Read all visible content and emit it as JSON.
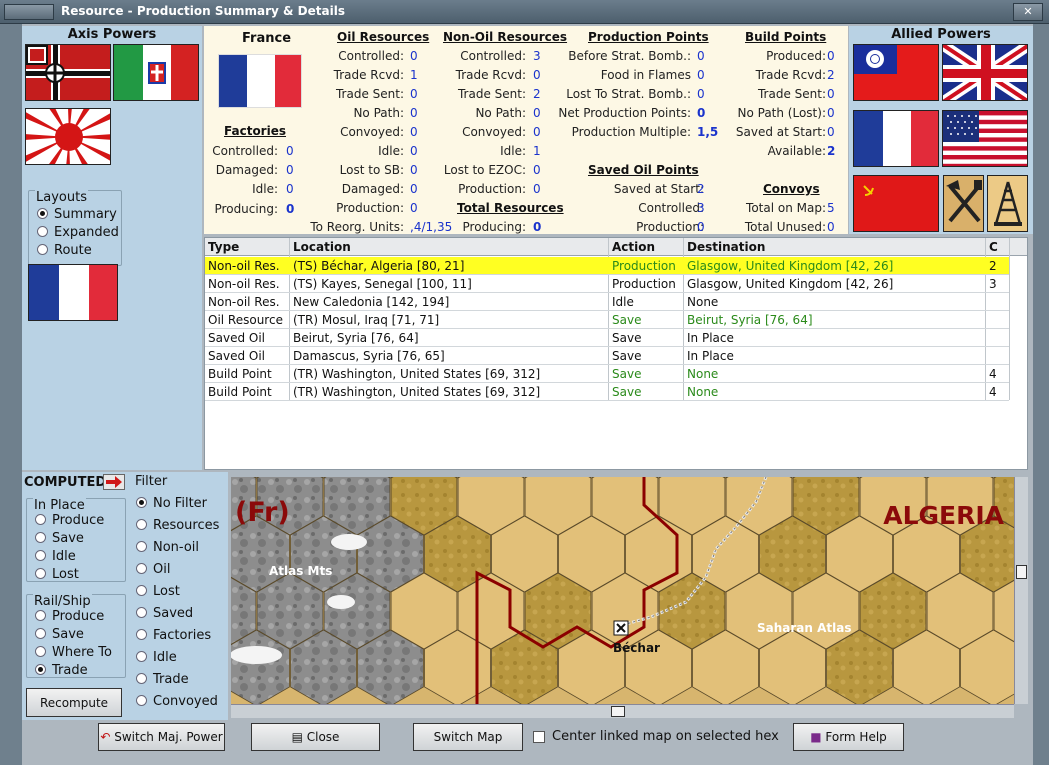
{
  "window": {
    "title": "Resource - Production Summary & Details",
    "close_glyph": "✕"
  },
  "axis": {
    "title": "Axis Powers"
  },
  "allied": {
    "title": "Allied Powers"
  },
  "layouts": {
    "title": "Layouts",
    "options": [
      "Summary",
      "Expanded",
      "Route"
    ],
    "selected": "Summary"
  },
  "summary": {
    "country": "France",
    "factories": {
      "title": "Factories",
      "rows": [
        {
          "label": "Controlled:",
          "value": "0"
        },
        {
          "label": "Damaged:",
          "value": "0"
        },
        {
          "label": "Idle:",
          "value": "0"
        },
        {
          "label": "Producing:",
          "value": "0"
        }
      ]
    },
    "oil": {
      "title": "Oil Resources",
      "rows": [
        {
          "label": "Controlled:",
          "value": "0"
        },
        {
          "label": "Trade Rcvd:",
          "value": "1"
        },
        {
          "label": "Trade Sent:",
          "value": "0"
        },
        {
          "label": "No Path:",
          "value": "0"
        },
        {
          "label": "Convoyed:",
          "value": "0"
        },
        {
          "label": "Idle:",
          "value": "0"
        },
        {
          "label": "Lost to SB:",
          "value": "0"
        },
        {
          "label": "Damaged:",
          "value": "0"
        },
        {
          "label": "Production:",
          "value": "0"
        },
        {
          "label": "To Reorg. Units:",
          "value": ",4/1,35"
        }
      ]
    },
    "nonoil": {
      "title": "Non-Oil Resources",
      "rows": [
        {
          "label": "Controlled:",
          "value": "3"
        },
        {
          "label": "Trade Rcvd:",
          "value": "0"
        },
        {
          "label": "Trade Sent:",
          "value": "2"
        },
        {
          "label": "No Path:",
          "value": "0"
        },
        {
          "label": "Convoyed:",
          "value": "0"
        },
        {
          "label": "Idle:",
          "value": "1"
        },
        {
          "label": "Lost to EZOC:",
          "value": "0"
        },
        {
          "label": "Production:",
          "value": "0"
        }
      ]
    },
    "total": {
      "title": "Total Resources",
      "label": "Producing:",
      "value": "0"
    },
    "pp": {
      "title": "Production Points",
      "rows": [
        {
          "label": "Before Strat. Bomb.:",
          "value": "0"
        },
        {
          "label": "Food in Flames",
          "value": "0"
        },
        {
          "label": "Lost To Strat. Bomb.:",
          "value": "0"
        },
        {
          "label": "Net Production Points:",
          "value": "0"
        },
        {
          "label": "Production Multiple:",
          "value": "1,5"
        }
      ]
    },
    "saved_oil": {
      "title": "Saved Oil Points",
      "rows": [
        {
          "label": "Saved at Start:",
          "value": "2"
        },
        {
          "label": "Controlled:",
          "value": "3"
        },
        {
          "label": "Production:",
          "value": "0"
        }
      ]
    },
    "bp": {
      "title": "Build Points",
      "rows": [
        {
          "label": "Produced:",
          "value": "0"
        },
        {
          "label": "Trade Rcvd:",
          "value": "2"
        },
        {
          "label": "Trade Sent:",
          "value": "0"
        },
        {
          "label": "No Path (Lost):",
          "value": "0"
        },
        {
          "label": "Saved at Start:",
          "value": "0"
        },
        {
          "label": "Available:",
          "value": "2"
        }
      ]
    },
    "convoys": {
      "title": "Convoys",
      "rows": [
        {
          "label": "Total on Map:",
          "value": "5"
        },
        {
          "label": "Total Unused:",
          "value": "0"
        }
      ]
    }
  },
  "table": {
    "headers": [
      "Type",
      "Location",
      "Action",
      "Destination",
      "C"
    ],
    "rows": [
      {
        "type": "Non-oil Res.",
        "location": "(TS) Béchar, Algeria [80, 21]",
        "action": "Production",
        "destination": "Glasgow, United Kingdom [42, 26]",
        "c": "2",
        "selected": true,
        "green": true
      },
      {
        "type": "Non-oil Res.",
        "location": "(TS) Kayes, Senegal [100, 11]",
        "action": "Production",
        "destination": "Glasgow, United Kingdom [42, 26]",
        "c": "3",
        "selected": false,
        "green": false
      },
      {
        "type": "Non-oil Res.",
        "location": "New Caledonia [142, 194]",
        "action": "Idle",
        "destination": "None",
        "c": "",
        "selected": false,
        "green": false
      },
      {
        "type": "Oil Resource",
        "location": "(TR) Mosul, Iraq [71, 71]",
        "action": "Save",
        "destination": "Beirut, Syria [76, 64]",
        "c": "",
        "selected": false,
        "green": true
      },
      {
        "type": "Saved Oil",
        "location": "Beirut, Syria [76, 64]",
        "action": "Save",
        "destination": "In Place",
        "c": "",
        "selected": false,
        "green": false
      },
      {
        "type": "Saved Oil",
        "location": "Damascus, Syria [76, 65]",
        "action": "Save",
        "destination": "In Place",
        "c": "",
        "selected": false,
        "green": false
      },
      {
        "type": "Build Point",
        "location": "(TR) Washington, United States [69, 312]",
        "action": "Save",
        "destination": "None",
        "c": "4",
        "selected": false,
        "green": true
      },
      {
        "type": "Build Point",
        "location": "(TR) Washington, United States [69, 312]",
        "action": "Save",
        "destination": "None",
        "c": "4",
        "selected": false,
        "green": true
      }
    ]
  },
  "computed": {
    "title": "COMPUTED",
    "in_place": {
      "title": "In Place",
      "options": [
        "Produce",
        "Save",
        "Idle",
        "Lost"
      ]
    },
    "rail_ship": {
      "title": "Rail/Ship",
      "options": [
        "Produce",
        "Save",
        "Where To",
        "Trade"
      ],
      "selected": "Trade"
    },
    "recompute_label": "Recompute"
  },
  "filter": {
    "title": "Filter",
    "options": [
      "No Filter",
      "Resources",
      "Non-oil",
      "Oil",
      "Lost",
      "Saved",
      "Factories",
      "Idle",
      "Trade",
      "Convoyed"
    ],
    "selected": "No Filter"
  },
  "map": {
    "country_tag": "(Fr)",
    "region_label": "ALGERIA",
    "labels": [
      "Atlas Mts",
      "Saharan Atlas",
      "Béchar"
    ]
  },
  "bottom": {
    "switch_power": "Switch Maj. Power",
    "close": "Close",
    "switch_map": "Switch Map",
    "center_checkbox": "Center linked map on selected hex",
    "form_help": "Form Help"
  },
  "colors": {
    "selection": "#ffff22",
    "value_blue": "#1a33cc",
    "green_text": "#2a8a1a",
    "border_red": "#8b0000"
  }
}
